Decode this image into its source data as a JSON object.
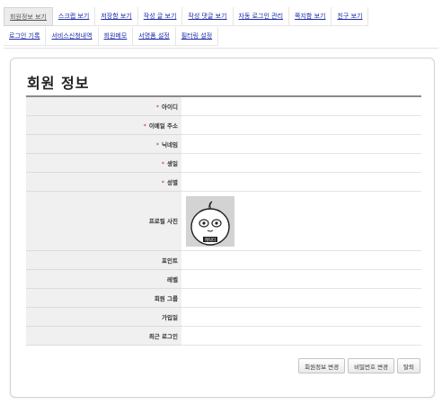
{
  "tabs": {
    "row1": [
      {
        "label": "회원정보 보기",
        "active": true
      },
      {
        "label": "스크랩 보기"
      },
      {
        "label": "저장함 보기"
      },
      {
        "label": "작성 글 보기"
      },
      {
        "label": "작성 댓글 보기"
      },
      {
        "label": "자동 로그인 관리"
      },
      {
        "label": "쪽지함 보기"
      },
      {
        "label": "친구 보기"
      }
    ],
    "row2": [
      {
        "label": "로그인 기록"
      },
      {
        "label": "서비스신청내역"
      },
      {
        "label": "회원메모"
      },
      {
        "label": "서명폼 설정"
      },
      {
        "label": "필터링 설정"
      }
    ]
  },
  "panel": {
    "title": "회원 정보",
    "required_mark": "*",
    "fields": {
      "user_id": "아이디",
      "email": "이메일 주소",
      "nickname": "닉네임",
      "birthday": "생일",
      "gender": "성별",
      "profile_photo": "프로필 사진",
      "points": "포인트",
      "level": "레벨",
      "member_group": "회원 그룹",
      "join_date": "가입일",
      "last_login": "최근 로그인"
    },
    "photo_caption": "캐릭터"
  },
  "buttons": {
    "edit_info": "회원정보 변경",
    "change_password": "비밀번호 변경",
    "withdraw": "탈퇴"
  }
}
